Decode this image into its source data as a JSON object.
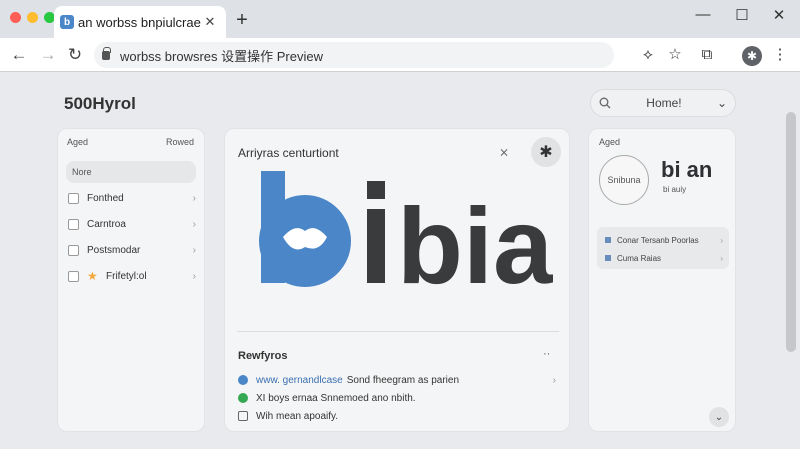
{
  "browser": {
    "tab": {
      "favicon": "b",
      "title": "an worbss bnpiulcrae",
      "close": "✕"
    },
    "newtab": "+",
    "window_controls": {
      "minimize": "—",
      "maximize": "☐",
      "close": "✕"
    },
    "toolbar": {
      "back": "←",
      "forward": "→",
      "reload": "↻",
      "url": "worbss browsres 设置操作 Preview",
      "icons": {
        "install": "⟡",
        "bookmark": "☆",
        "extensions": "⧉",
        "profile": "✱",
        "menu": "⋮"
      }
    }
  },
  "page": {
    "title": "500Hyrol",
    "search": {
      "label": "Home!",
      "icon": "search-icon",
      "chevron": "⌄"
    },
    "left_panel": {
      "header_left": "Aged",
      "header_right": "Rowed",
      "selected": "Nore",
      "items": [
        {
          "label": "Fonthed",
          "icon": "document-icon"
        },
        {
          "label": "Carntroa",
          "icon": "calendar-icon"
        },
        {
          "label": "Postsmodar",
          "icon": "chart-icon"
        },
        {
          "label": "Frifetyl:ol",
          "icon": "star-icon"
        }
      ]
    },
    "center_panel": {
      "heading": "Arriyras centurtiont",
      "icon_left": "⨯",
      "icon_right": "✱",
      "logo_text": "bian",
      "logo_colors": {
        "blue": "#4a86c8",
        "dark": "#3a3b3d"
      },
      "recent": {
        "heading": "Rewfyros",
        "more": "··",
        "items": [
          {
            "link": "www. gernandlcase",
            "text": "Sond fheegram as parien",
            "icon": "shield-icon"
          },
          {
            "link": "",
            "text": "XI boys ernaa Snnemoed ano nbith.",
            "icon": "check-icon"
          },
          {
            "link": "",
            "text": "Wih mean apoaify.",
            "icon": "grid-icon"
          }
        ]
      }
    },
    "right_panel": {
      "header": "Aged",
      "seal_text": "Snibuna",
      "brand": "bi an",
      "brand_sub": "bi auiy",
      "items": [
        {
          "label": "Conar Tersanb Poorlas"
        },
        {
          "label": "Cuma Raias"
        }
      ]
    }
  }
}
